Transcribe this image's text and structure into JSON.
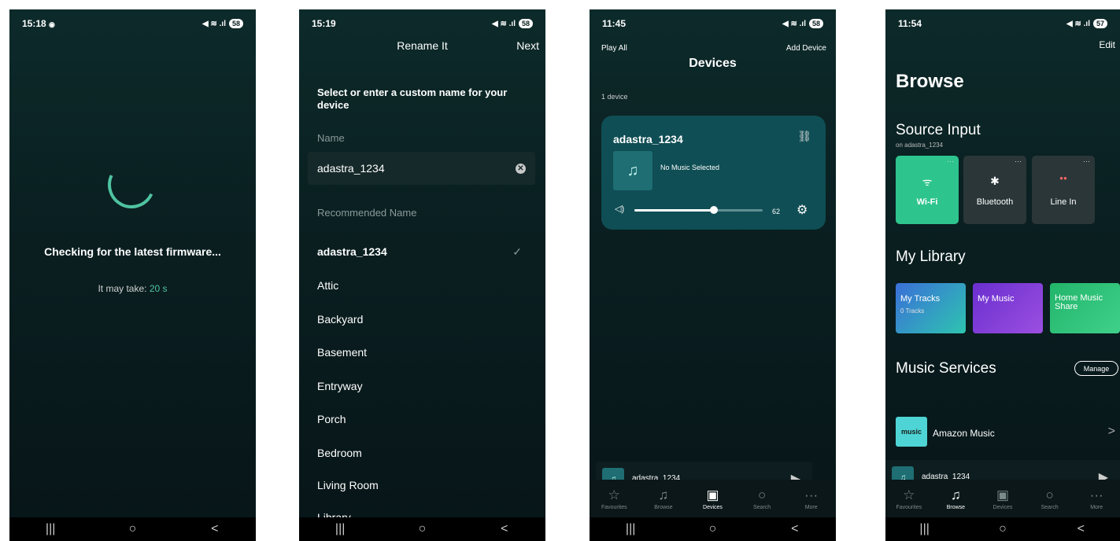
{
  "nav_buttons": {
    "recents": "|||",
    "home": "○",
    "back": "<"
  },
  "phone1": {
    "time": "15:18",
    "status_icons": "◉",
    "signal": "◀ ≋ .ıl",
    "battery": "58",
    "title": "Checking for the latest firmware...",
    "wait_prefix": "It may take:",
    "wait_value": "20 s"
  },
  "phone2": {
    "time": "15:19",
    "signal": "◀ ≋ .ıl",
    "battery": "58",
    "header_title": "Rename It",
    "next": "Next",
    "instruction": "Select or enter a custom name for your device",
    "name_label": "Name",
    "name_value": "adastra_1234",
    "recommended_label": "Recommended Name",
    "names": [
      "adastra_1234",
      "Attic",
      "Backyard",
      "Basement",
      "Entryway",
      "Porch",
      "Bedroom",
      "Living Room",
      "Library"
    ]
  },
  "phone3": {
    "time": "11:45",
    "signal": "◀ ≋ .ıl",
    "battery": "58",
    "play_all": "Play All",
    "add_device": "Add Device",
    "title": "Devices",
    "device_count": "1 device",
    "device_name": "adastra_1234",
    "no_music": "No Music Selected",
    "volume": 62,
    "volume_label": "62",
    "mini_name": "adastra_1234",
    "tabs": [
      {
        "icon": "☆",
        "label": "Favourites"
      },
      {
        "icon": "♫",
        "label": "Browse"
      },
      {
        "icon": "▣",
        "label": "Devices"
      },
      {
        "icon": "○",
        "label": "Search"
      },
      {
        "icon": "···",
        "label": "More"
      }
    ],
    "active_tab": 2
  },
  "phone4": {
    "time": "11:54",
    "signal": "◀ ≋ .ıl",
    "battery": "57",
    "edit": "Edit",
    "browse": "Browse",
    "source_input": "Source Input",
    "source_sub": "on adastra_1234",
    "sources": [
      {
        "icon": "ᯤ",
        "label": "Wi-Fi"
      },
      {
        "icon": "✱",
        "label": "Bluetooth"
      },
      {
        "icon": "●●",
        "label": "Line In"
      }
    ],
    "my_library": "My Library",
    "library": [
      {
        "title": "My Tracks",
        "sub": "0 Tracks",
        "color": "#3a7bd5"
      },
      {
        "title": "My Music",
        "sub": "",
        "color": "#7b3fc9"
      },
      {
        "title": "Home Music Share",
        "sub": "",
        "color": "#2fbf71"
      }
    ],
    "music_services": "Music Services",
    "manage": "Manage",
    "amazon_logo": "music",
    "amazon_name": "Amazon Music",
    "mini_name": "adastra_1234",
    "tabs": [
      {
        "icon": "☆",
        "label": "Favourites"
      },
      {
        "icon": "♫",
        "label": "Browse"
      },
      {
        "icon": "▣",
        "label": "Devices"
      },
      {
        "icon": "○",
        "label": "Search"
      },
      {
        "icon": "···",
        "label": "More"
      }
    ],
    "active_tab": 1
  }
}
